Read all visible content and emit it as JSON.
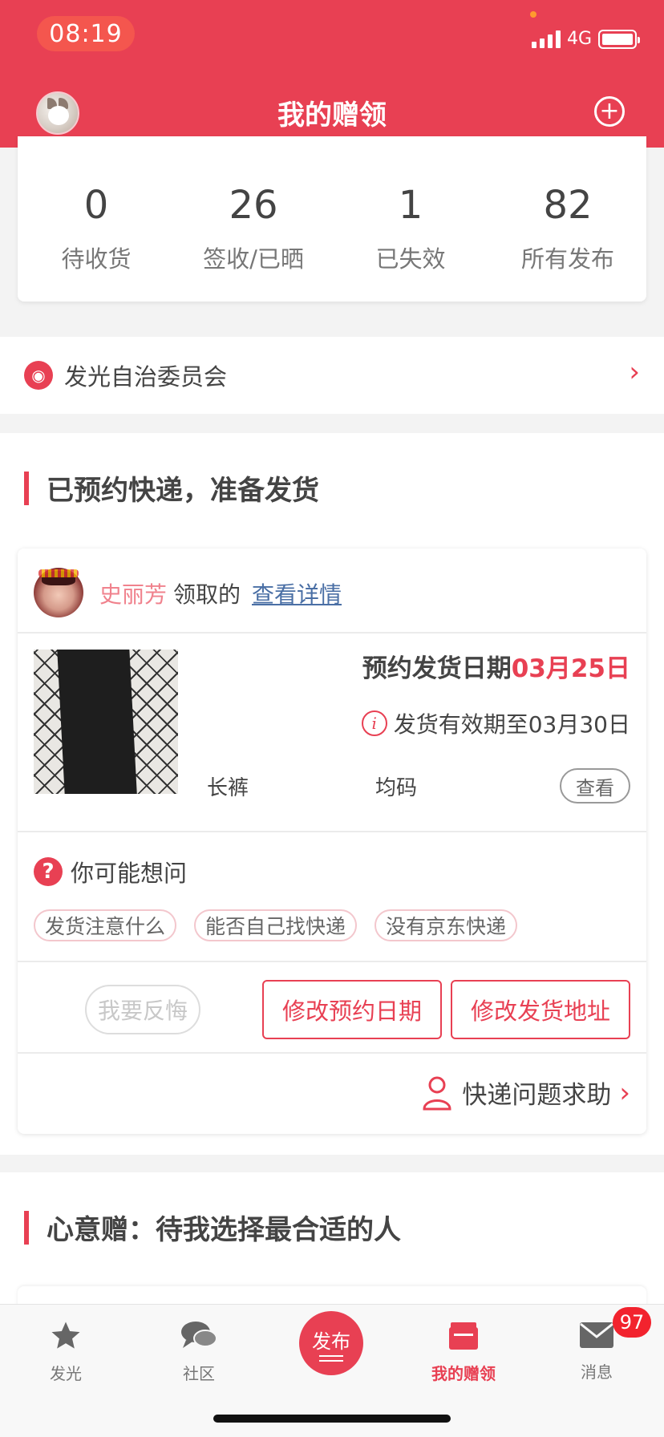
{
  "status_bar": {
    "time": "08:19",
    "network": "4G"
  },
  "header": {
    "title": "我的赠领",
    "add_icon": "plus-circle-icon"
  },
  "stats": [
    {
      "value": "0",
      "label": "待收货"
    },
    {
      "value": "26",
      "label": "签收/已晒"
    },
    {
      "value": "1",
      "label": "已失效"
    },
    {
      "value": "82",
      "label": "所有发布"
    }
  ],
  "committee": {
    "label": "发光自治委员会"
  },
  "section1": {
    "title": "已预约快递，准备发货",
    "order": {
      "user_name": "史丽芳",
      "taken_text": "领取的",
      "detail_link": "查看详情",
      "ship_date_label": "预约发货日期",
      "ship_date": "03月25日",
      "valid_text": "发货有效期至03月30日",
      "product_name": "长裤",
      "product_size": "均码",
      "view_label": "查看",
      "faq_title": "你可能想问",
      "faq_chips": [
        "发货注意什么",
        "能否自己找快递",
        "没有京东快递"
      ],
      "regret_label": "我要反悔",
      "change_date_label": "修改预约日期",
      "change_address_label": "修改发货地址",
      "help_label": "快递问题求助"
    }
  },
  "section2": {
    "title": "心意赠：待我选择最合适的人"
  },
  "tabbar": {
    "tabs": [
      {
        "label": "发光",
        "icon": "star-icon"
      },
      {
        "label": "社区",
        "icon": "chat-bubbles-icon"
      },
      {
        "label": "发布",
        "icon": "publish-icon"
      },
      {
        "label": "我的赠领",
        "icon": "gift-box-icon"
      },
      {
        "label": "消息",
        "icon": "envelope-icon"
      }
    ],
    "message_badge": "97"
  },
  "colors": {
    "brand_red": "#e84053",
    "link_blue": "#4a6fa5",
    "user_pink": "#f0828d"
  }
}
